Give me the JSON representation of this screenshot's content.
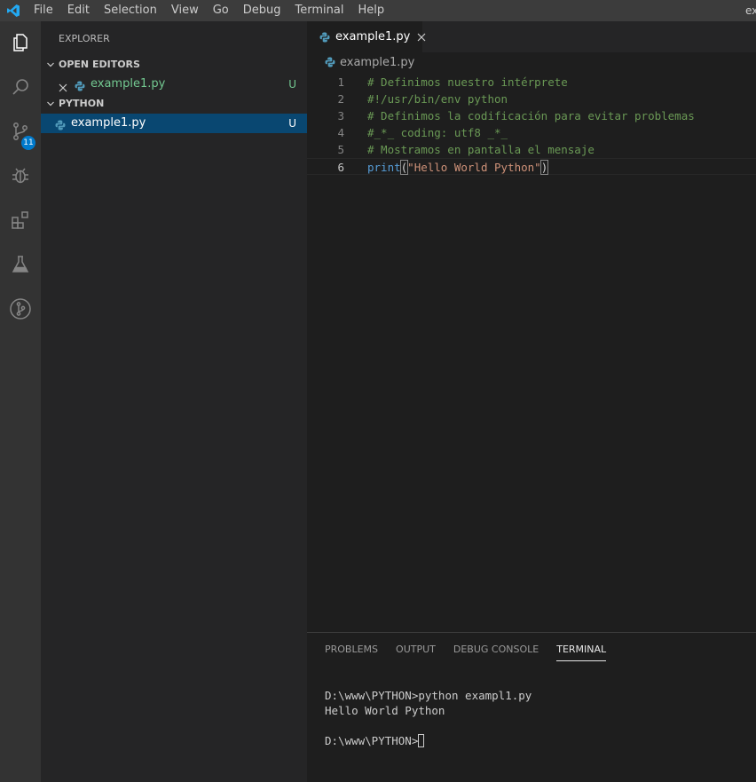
{
  "menu": {
    "items": [
      "File",
      "Edit",
      "Selection",
      "View",
      "Go",
      "Debug",
      "Terminal",
      "Help"
    ],
    "window_title": "ex"
  },
  "activity_bar": {
    "icons": [
      "explorer-icon",
      "search-icon",
      "source-control-icon",
      "debug-icon",
      "extensions-icon",
      "test-flask-icon",
      "git-graph-icon"
    ],
    "source_control_badge": "11"
  },
  "sidebar": {
    "title": "EXPLORER",
    "open_editors": {
      "header": "OPEN EDITORS",
      "items": [
        {
          "name": "example1.py",
          "status": "U"
        }
      ]
    },
    "folder": {
      "header": "PYTHON",
      "items": [
        {
          "name": "example1.py",
          "status": "U"
        }
      ]
    }
  },
  "editor": {
    "tab_label": "example1.py",
    "breadcrumb": "example1.py",
    "lines": [
      {
        "num": "1",
        "text": "# Definimos nuestro intérprete"
      },
      {
        "num": "2",
        "text": "#!/usr/bin/env python"
      },
      {
        "num": "3",
        "text": "# Definimos la codificación para evitar problemas"
      },
      {
        "num": "4",
        "text": "#_*_ coding: utf8 _*_"
      },
      {
        "num": "5",
        "text": "# Mostramos en pantalla el mensaje"
      },
      {
        "num": "6",
        "keyword": "print",
        "open_paren": "(",
        "string": "\"Hello World Python\"",
        "close_paren": ")"
      }
    ]
  },
  "panel": {
    "tabs": [
      "PROBLEMS",
      "OUTPUT",
      "DEBUG CONSOLE",
      "TERMINAL"
    ],
    "active_tab": "TERMINAL",
    "terminal_lines": [
      "D:\\www\\PYTHON>python exampl1.py",
      "Hello World Python",
      ""
    ],
    "prompt": "D:\\www\\PYTHON>"
  },
  "colors": {
    "accent": "#007acc",
    "untracked_green": "#73c991",
    "selection": "#094771",
    "comment": "#6a9955",
    "keyword": "#569cd6",
    "string": "#ce9178"
  }
}
